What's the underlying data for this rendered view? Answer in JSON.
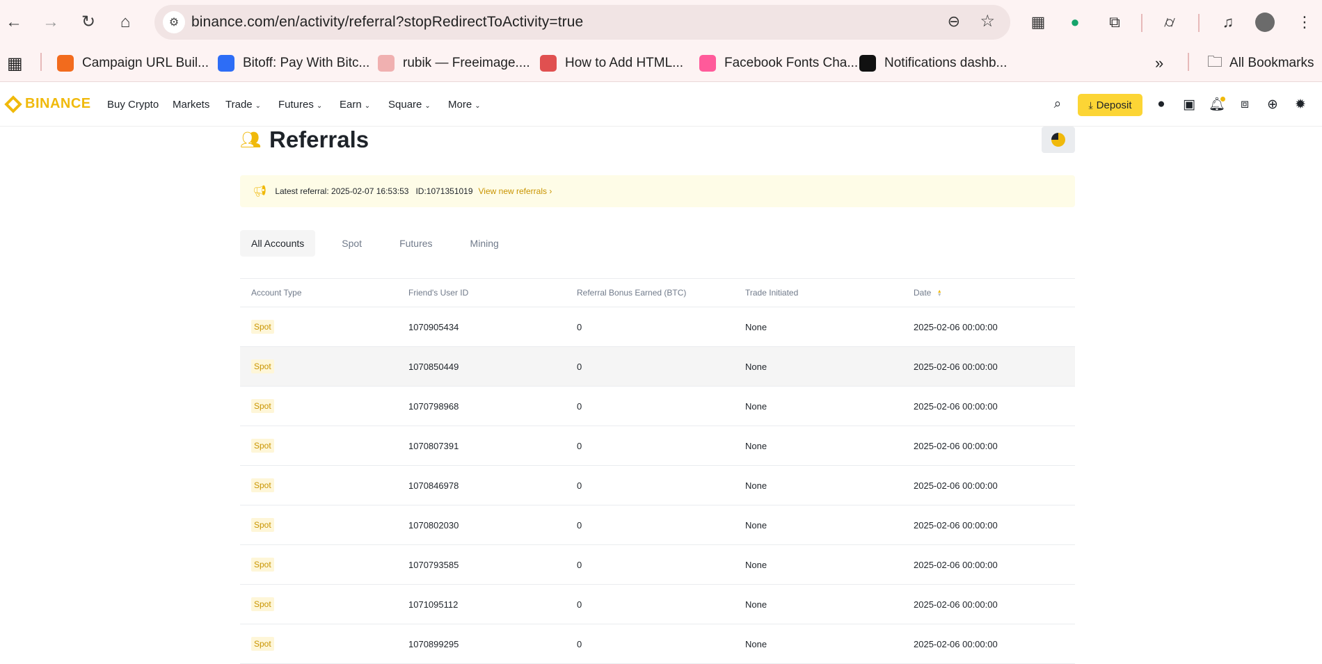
{
  "browser": {
    "url": "binance.com/en/activity/referral?stopRedirectToActivity=true",
    "bookmarks": [
      {
        "label": "Campaign URL Buil...",
        "icon": "campaign-icon",
        "color": "#f26b1d"
      },
      {
        "label": "Bitoff: Pay With Bitc...",
        "icon": "bitoff-icon",
        "color": "#2d6df6"
      },
      {
        "label": "rubik — Freeimage....",
        "icon": "freeimage-icon",
        "color": "#f0b0b0"
      },
      {
        "label": "How to Add HTML...",
        "icon": "html-icon",
        "color": "#e05050"
      },
      {
        "label": "Facebook Fonts Cha...",
        "icon": "fonts-icon",
        "color": "#ff5a9a"
      },
      {
        "label": "Notifications dashb...",
        "icon": "notifications-icon",
        "color": "#111111"
      }
    ],
    "all_bookmarks": "All Bookmarks"
  },
  "header": {
    "logo": "BINANCE",
    "menu": [
      {
        "label": "Buy Crypto",
        "caret": false
      },
      {
        "label": "Markets",
        "caret": false
      },
      {
        "label": "Trade",
        "caret": true
      },
      {
        "label": "Futures",
        "caret": true
      },
      {
        "label": "Earn",
        "caret": true
      },
      {
        "label": "Square",
        "caret": true
      },
      {
        "label": "More",
        "caret": true
      }
    ],
    "deposit_label": "Deposit",
    "accent": "#fcd535"
  },
  "page": {
    "title": "Referrals",
    "notice": {
      "text": "Latest referral: 2025-02-07 16:53:53   ID:1071351019",
      "link": "View new referrals ›"
    },
    "tabs": [
      "All Accounts",
      "Spot",
      "Futures",
      "Mining"
    ],
    "active_tab": "All Accounts"
  },
  "table": {
    "columns": [
      "Account Type",
      "Friend's User ID",
      "Referral Bonus Earned (BTC)",
      "Trade Initiated",
      "Date"
    ],
    "rows": [
      {
        "type": "Spot",
        "id": "1070905434",
        "bonus": "0",
        "trade": "None",
        "date": "2025-02-06 00:00:00"
      },
      {
        "type": "Spot",
        "id": "1070850449",
        "bonus": "0",
        "trade": "None",
        "date": "2025-02-06 00:00:00"
      },
      {
        "type": "Spot",
        "id": "1070798968",
        "bonus": "0",
        "trade": "None",
        "date": "2025-02-06 00:00:00"
      },
      {
        "type": "Spot",
        "id": "1070807391",
        "bonus": "0",
        "trade": "None",
        "date": "2025-02-06 00:00:00"
      },
      {
        "type": "Spot",
        "id": "1070846978",
        "bonus": "0",
        "trade": "None",
        "date": "2025-02-06 00:00:00"
      },
      {
        "type": "Spot",
        "id": "1070802030",
        "bonus": "0",
        "trade": "None",
        "date": "2025-02-06 00:00:00"
      },
      {
        "type": "Spot",
        "id": "1070793585",
        "bonus": "0",
        "trade": "None",
        "date": "2025-02-06 00:00:00"
      },
      {
        "type": "Spot",
        "id": "1071095112",
        "bonus": "0",
        "trade": "None",
        "date": "2025-02-06 00:00:00"
      },
      {
        "type": "Spot",
        "id": "1070899295",
        "bonus": "0",
        "trade": "None",
        "date": "2025-02-06 00:00:00"
      }
    ]
  }
}
